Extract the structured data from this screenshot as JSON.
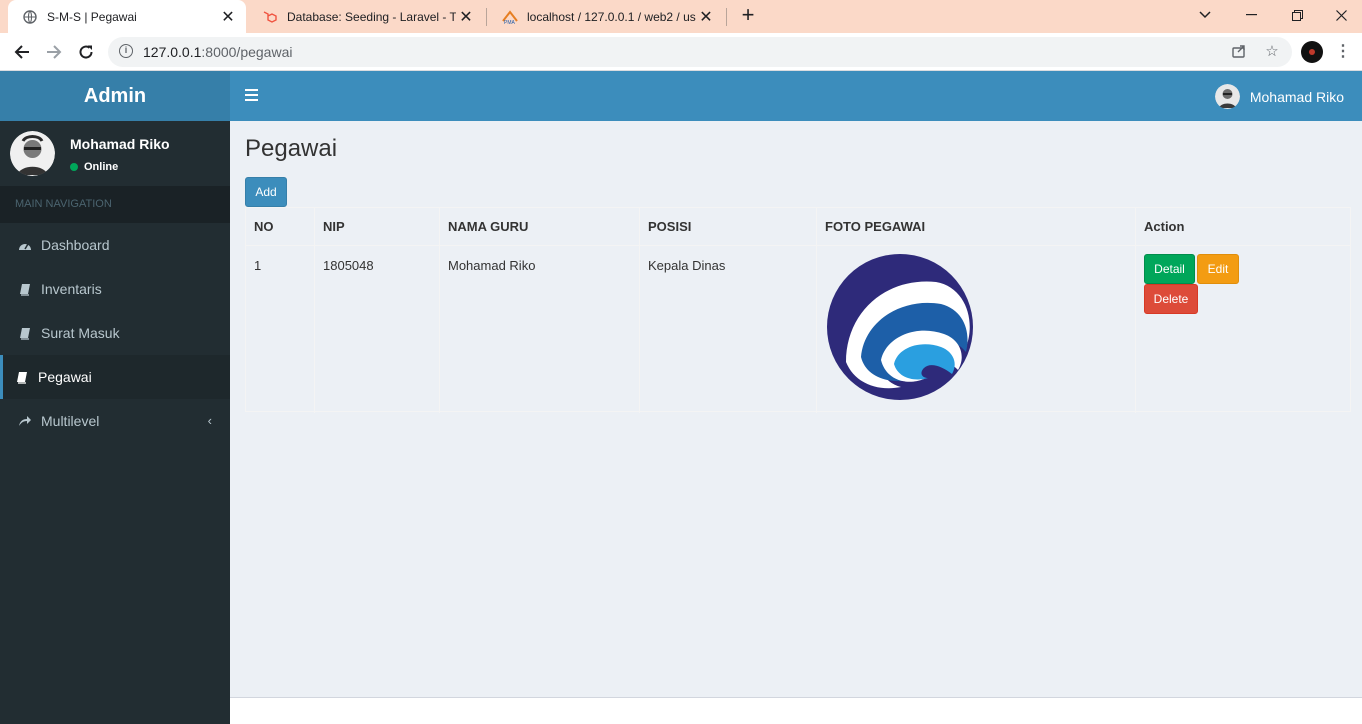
{
  "browser": {
    "tabs": [
      {
        "title": "S-M-S | Pegawai",
        "icon": "globe-icon"
      },
      {
        "title": "Database: Seeding - Laravel - The",
        "icon": "laravel-icon"
      },
      {
        "title": "localhost / 127.0.0.1 / web2 / use",
        "icon": "phpmyadmin-icon"
      }
    ],
    "url_host": "127.0.0.1",
    "url_path": ":8000/pegawai"
  },
  "app": {
    "logo": "Admin",
    "navbar_user": "Mohamad Riko",
    "sidebar": {
      "user_name": "Mohamad Riko",
      "user_status": "Online",
      "nav_header": "MAIN NAVIGATION",
      "items": [
        {
          "label": "Dashboard",
          "icon": "dashboard-icon"
        },
        {
          "label": "Inventaris",
          "icon": "book-icon"
        },
        {
          "label": "Surat Masuk",
          "icon": "book-icon"
        },
        {
          "label": "Pegawai",
          "icon": "book-icon"
        },
        {
          "label": "Multilevel",
          "icon": "share-icon"
        }
      ]
    },
    "page_title": "Pegawai",
    "add_label": "Add",
    "table": {
      "headers": [
        "NO",
        "NIP",
        "NAMA GURU",
        "POSISI",
        "FOTO PEGAWAI",
        "Action"
      ],
      "rows": [
        {
          "no": "1",
          "nip": "1805048",
          "nama": "Mohamad Riko",
          "posisi": "Kepala Dinas"
        }
      ],
      "detail_label": "Detail",
      "edit_label": "Edit",
      "delete_label": "Delete"
    }
  },
  "colors": {
    "navbar": "#3c8dbc",
    "logo_bg": "#367fa9",
    "sidebar": "#222d32",
    "success": "#00a65a",
    "warning": "#f39c12",
    "danger": "#dd4b39"
  }
}
